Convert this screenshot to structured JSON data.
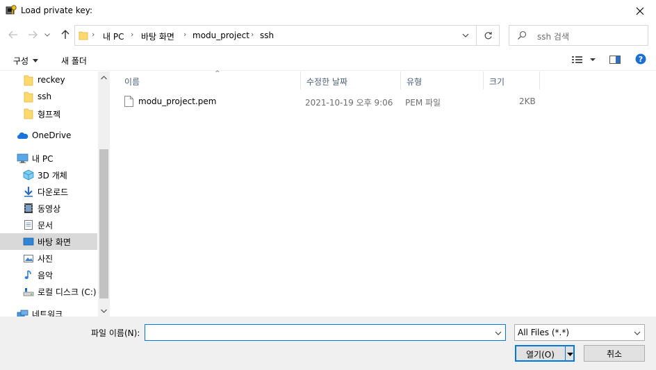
{
  "window": {
    "title": "Load private key:"
  },
  "address": {
    "crumbs": [
      "내 PC",
      "바탕 화면",
      "modu_project",
      "ssh"
    ]
  },
  "search": {
    "placeholder": "ssh 검색"
  },
  "toolbar": {
    "organize_label": "구성",
    "new_folder_label": "새 폴더"
  },
  "sidebar": {
    "items": [
      {
        "label": "reckey",
        "icon": "folder-icon"
      },
      {
        "label": "ssh",
        "icon": "folder-icon"
      },
      {
        "label": "형프젝",
        "icon": "folder-icon"
      },
      {
        "label": "OneDrive",
        "icon": "cloud-icon"
      },
      {
        "label": "내 PC",
        "icon": "computer-icon"
      },
      {
        "label": "3D 개체",
        "icon": "cube-icon"
      },
      {
        "label": "다운로드",
        "icon": "download-icon"
      },
      {
        "label": "동영상",
        "icon": "video-icon"
      },
      {
        "label": "문서",
        "icon": "document-icon"
      },
      {
        "label": "바탕 화면",
        "icon": "desktop-icon",
        "selected": true
      },
      {
        "label": "사진",
        "icon": "pictures-icon"
      },
      {
        "label": "음악",
        "icon": "music-icon"
      },
      {
        "label": "로컬 디스크 (C:)",
        "icon": "drive-icon"
      },
      {
        "label": "네트워크",
        "icon": "network-icon"
      }
    ]
  },
  "filelist": {
    "columns": [
      "이름",
      "수정한 날짜",
      "유형",
      "크기"
    ],
    "rows": [
      {
        "name": "modu_project.pem",
        "modified": "2021-10-19 오후 9:06",
        "type": "PEM 파일",
        "size": "2KB"
      }
    ]
  },
  "bottom": {
    "filename_label": "파일 이름(N):",
    "filename_value": "",
    "filetype_value": "All Files (*.*)",
    "open_label": "열기(O)",
    "cancel_label": "취소"
  },
  "colors": {
    "accent": "#0078d7",
    "selected_bg": "#d9d9d9",
    "header_text": "#4c607a"
  }
}
